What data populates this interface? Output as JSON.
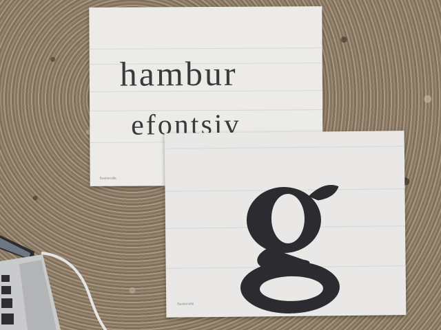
{
  "sheet_top": {
    "line1": "hambur",
    "line2": "efontsiv",
    "footer": "Baskerville"
  },
  "sheet_bottom": {
    "glyph": "g",
    "footer": "Baskerville"
  },
  "colors": {
    "paper": "#ecebe8",
    "ink": "#3a3a3c",
    "marker": "#2b2b30"
  }
}
